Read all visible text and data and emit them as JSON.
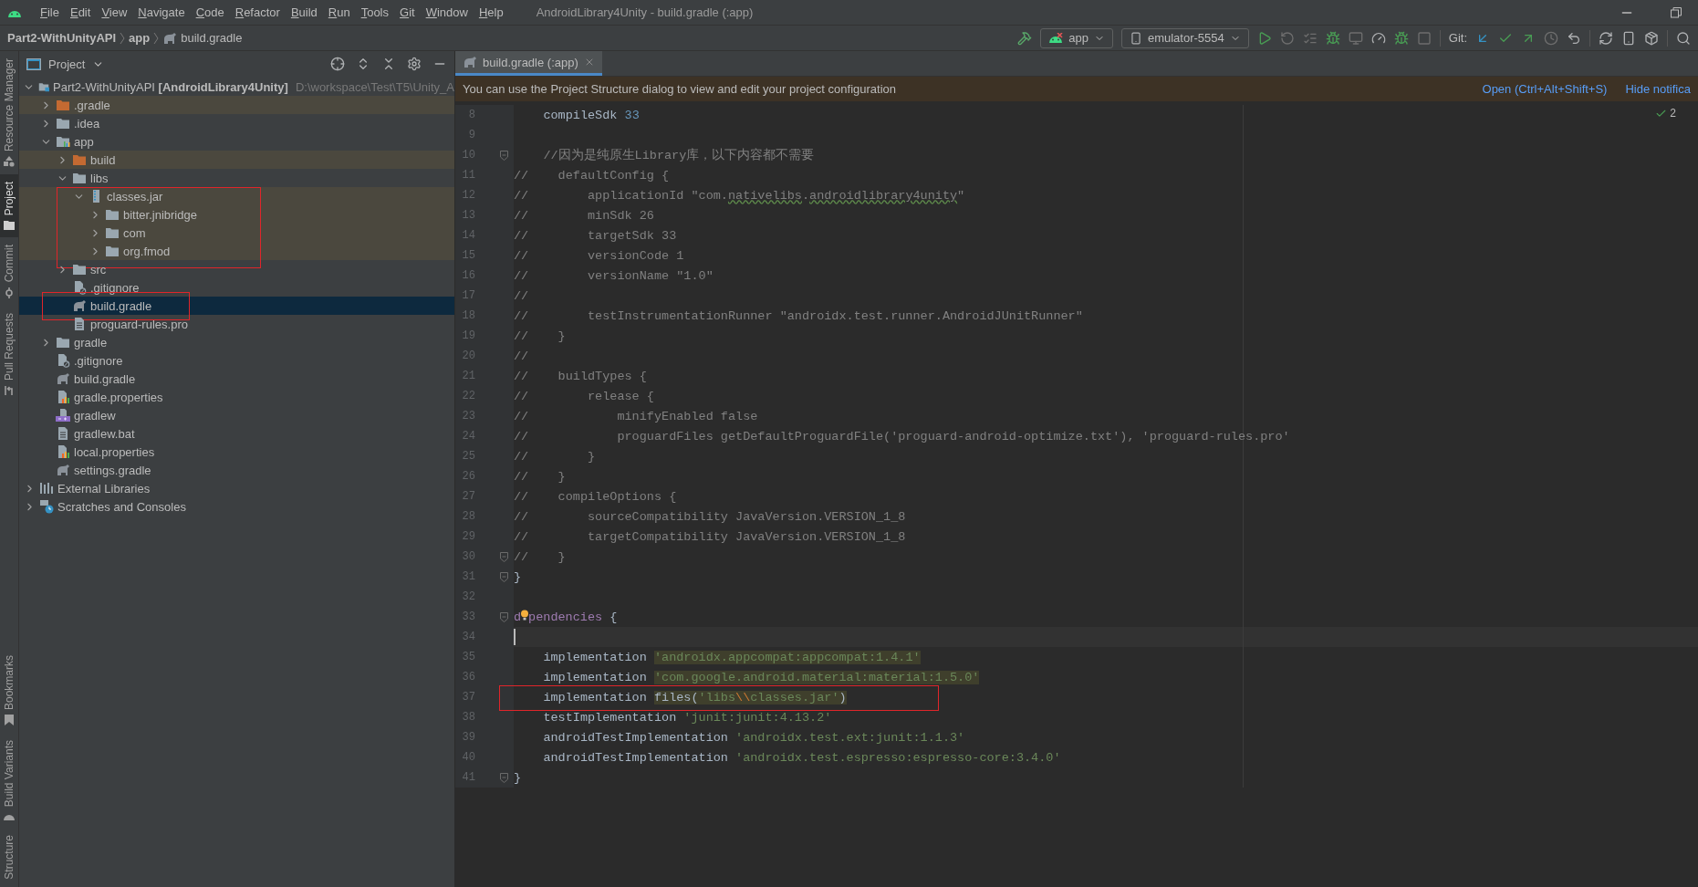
{
  "menu_bar": {
    "items": [
      "File",
      "Edit",
      "View",
      "Navigate",
      "Code",
      "Refactor",
      "Build",
      "Run",
      "Tools",
      "Git",
      "Window",
      "Help"
    ],
    "title": "AndroidLibrary4Unity - build.gradle (:app)"
  },
  "nav_bar": {
    "breadcrumbs": [
      {
        "label": "Part2-WithUnityAPI",
        "kind": "project"
      },
      {
        "label": "app",
        "kind": "module"
      },
      {
        "label": "build.gradle",
        "kind": "gradle"
      }
    ]
  },
  "toolbar": {
    "config": "app",
    "device": "emulator-5554",
    "git_label": "Git:"
  },
  "side_stripe": {
    "top": [
      {
        "label": "Resource Manager",
        "selected": false
      },
      {
        "label": "Project",
        "selected": true
      },
      {
        "label": "Commit",
        "selected": false
      },
      {
        "label": "Pull Requests",
        "selected": false
      }
    ],
    "bottom": [
      {
        "label": "Bookmarks",
        "selected": false
      },
      {
        "label": "Build Variants",
        "selected": false
      },
      {
        "label": "Structure",
        "selected": false
      }
    ]
  },
  "project_panel": {
    "title": "Project",
    "tree": [
      {
        "label": "Part2-WithUnityAPI **[AndroidLibrary4Unity]**",
        "hint": "D:\\workspace\\Test\\T5\\Unity_A",
        "kind": "module-root",
        "expanded": true,
        "selected": false,
        "tinted": false,
        "children": [
          {
            "label": ".gradle",
            "kind": "excluded-folder",
            "expanded": false,
            "selected": false,
            "tinted": true
          },
          {
            "label": ".idea",
            "kind": "folder",
            "expanded": false,
            "selected": false,
            "tinted": false
          },
          {
            "label": "app",
            "kind": "module",
            "expanded": true,
            "selected": false,
            "tinted": false,
            "children": [
              {
                "label": "build",
                "kind": "excluded-folder",
                "expanded": false,
                "selected": false,
                "tinted": true
              },
              {
                "label": "libs",
                "kind": "folder",
                "expanded": true,
                "selected": false,
                "tinted": false,
                "children": [
                  {
                    "label": "classes.jar",
                    "kind": "jar",
                    "expanded": true,
                    "selected": false,
                    "tinted": true,
                    "annotated": true,
                    "children": [
                      {
                        "label": "bitter.jnibridge",
                        "kind": "folder",
                        "expanded": false,
                        "selected": false,
                        "tinted": true
                      },
                      {
                        "label": "com",
                        "kind": "folder",
                        "expanded": false,
                        "selected": false,
                        "tinted": true
                      },
                      {
                        "label": "org.fmod",
                        "kind": "folder",
                        "expanded": false,
                        "selected": false,
                        "tinted": true
                      }
                    ]
                  }
                ]
              },
              {
                "label": "src",
                "kind": "folder",
                "expanded": false,
                "selected": false,
                "tinted": false
              },
              {
                "label": ".gitignore",
                "kind": "ignore",
                "selected": false,
                "tinted": false
              },
              {
                "label": "build.gradle",
                "kind": "gradle",
                "selected": true,
                "tinted": false,
                "annotated": true
              },
              {
                "label": "proguard-rules.pro",
                "kind": "text",
                "selected": false,
                "tinted": false
              }
            ]
          },
          {
            "label": "gradle",
            "kind": "folder",
            "expanded": false,
            "selected": false,
            "tinted": false
          },
          {
            "label": ".gitignore",
            "kind": "ignore",
            "selected": false,
            "tinted": false
          },
          {
            "label": "build.gradle",
            "kind": "gradle",
            "selected": false,
            "tinted": false
          },
          {
            "label": "gradle.properties",
            "kind": "properties",
            "selected": false,
            "tinted": false
          },
          {
            "label": "gradlew",
            "kind": "script",
            "selected": false,
            "tinted": false
          },
          {
            "label": "gradlew.bat",
            "kind": "text",
            "selected": false,
            "tinted": false
          },
          {
            "label": "local.properties",
            "kind": "properties",
            "selected": false,
            "tinted": false
          },
          {
            "label": "settings.gradle",
            "kind": "gradle",
            "selected": false,
            "tinted": false
          }
        ]
      },
      {
        "label": "External Libraries",
        "kind": "libraries",
        "expanded": false,
        "selected": false,
        "tinted": false
      },
      {
        "label": "Scratches and Consoles",
        "kind": "scratches",
        "expanded": false,
        "selected": false,
        "tinted": false
      }
    ]
  },
  "editor": {
    "tab": {
      "label": "build.gradle (:app)",
      "selected": true
    },
    "notification": {
      "text": "You can use the Project Structure dialog to view and edit your project configuration",
      "links": [
        "Open (Ctrl+Alt+Shift+S)",
        "Hide notifica"
      ]
    },
    "inspection_count": "2",
    "lines": [
      {
        "number": "8",
        "tokens": [
          {
            "text": "    compileSdk ",
            "kind": "plain"
          },
          {
            "text": "33",
            "kind": "number"
          }
        ]
      },
      {
        "number": "9"
      },
      {
        "number": "10",
        "fold": true,
        "tokens": [
          {
            "text": "    //因为是纯原生Library库，以下内容都不需要",
            "kind": "comment"
          }
        ]
      },
      {
        "number": "11",
        "tokens": [
          {
            "text": "//    defaultConfig {",
            "kind": "comment"
          }
        ]
      },
      {
        "number": "12",
        "tokens": [
          {
            "text": "//        applicationId \"com.",
            "kind": "comment"
          },
          {
            "text": "nativelibs",
            "kind": "typo"
          },
          {
            "text": ".",
            "kind": "comment"
          },
          {
            "text": "androidlibrary4unity",
            "kind": "typo"
          },
          {
            "text": "\"",
            "kind": "comment"
          }
        ]
      },
      {
        "number": "13",
        "tokens": [
          {
            "text": "//        minSdk 26",
            "kind": "comment"
          }
        ]
      },
      {
        "number": "14",
        "tokens": [
          {
            "text": "//        targetSdk 33",
            "kind": "comment"
          }
        ]
      },
      {
        "number": "15",
        "tokens": [
          {
            "text": "//        versionCode 1",
            "kind": "comment"
          }
        ]
      },
      {
        "number": "16",
        "tokens": [
          {
            "text": "//        versionName \"1.0\"",
            "kind": "comment"
          }
        ]
      },
      {
        "number": "17",
        "tokens": [
          {
            "text": "//",
            "kind": "comment"
          }
        ]
      },
      {
        "number": "18",
        "tokens": [
          {
            "text": "//        testInstrumentationRunner \"androidx.test.runner.AndroidJUnitRunner\"",
            "kind": "comment"
          }
        ]
      },
      {
        "number": "19",
        "tokens": [
          {
            "text": "//    }",
            "kind": "comment"
          }
        ]
      },
      {
        "number": "20",
        "tokens": [
          {
            "text": "//",
            "kind": "comment"
          }
        ]
      },
      {
        "number": "21",
        "tokens": [
          {
            "text": "//    buildTypes {",
            "kind": "comment"
          }
        ]
      },
      {
        "number": "22",
        "tokens": [
          {
            "text": "//        release {",
            "kind": "comment"
          }
        ]
      },
      {
        "number": "23",
        "tokens": [
          {
            "text": "//            minifyEnabled false",
            "kind": "comment"
          }
        ]
      },
      {
        "number": "24",
        "tokens": [
          {
            "text": "//            proguardFiles getDefaultProguardFile('proguard-android-optimize.txt'), 'proguard-rules.pro'",
            "kind": "comment"
          }
        ]
      },
      {
        "number": "25",
        "tokens": [
          {
            "text": "//        }",
            "kind": "comment"
          }
        ]
      },
      {
        "number": "26",
        "tokens": [
          {
            "text": "//    }",
            "kind": "comment"
          }
        ]
      },
      {
        "number": "27",
        "tokens": [
          {
            "text": "//    compileOptions {",
            "kind": "comment"
          }
        ]
      },
      {
        "number": "28",
        "tokens": [
          {
            "text": "//        sourceCompatibility JavaVersion.VERSION_1_8",
            "kind": "comment"
          }
        ]
      },
      {
        "number": "29",
        "tokens": [
          {
            "text": "//        targetCompatibility JavaVersion.VERSION_1_8",
            "kind": "comment"
          }
        ]
      },
      {
        "number": "30",
        "fold": true,
        "tokens": [
          {
            "text": "//    }",
            "kind": "comment"
          }
        ]
      },
      {
        "number": "31",
        "fold": true,
        "tokens": [
          {
            "text": "}",
            "kind": "plain"
          }
        ]
      },
      {
        "number": "32"
      },
      {
        "number": "33",
        "fold": true,
        "tokens": [
          {
            "text": "d",
            "kind": "method"
          },
          {
            "kind": "bulb"
          },
          {
            "text": "pendencies",
            "kind": "method"
          },
          {
            "text": " {",
            "kind": "plain"
          }
        ]
      },
      {
        "number": "34",
        "current": true
      },
      {
        "number": "35",
        "tokens": [
          {
            "text": "    implementation ",
            "kind": "plain"
          },
          {
            "text": "'androidx.appcompat:appcompat:1.4.1'",
            "kind": "string",
            "marked": true
          }
        ]
      },
      {
        "number": "36",
        "tokens": [
          {
            "text": "    implementation ",
            "kind": "plain"
          },
          {
            "text": "'com.google.android.material:material:1.5.0'",
            "kind": "string",
            "marked": true
          }
        ]
      },
      {
        "number": "37",
        "annotated": true,
        "tokens": [
          {
            "text": "    implementation ",
            "kind": "plain"
          },
          {
            "text": "files(",
            "kind": "plain",
            "marked": true
          },
          {
            "text": "'libs",
            "kind": "string",
            "marked": true
          },
          {
            "text": "\\\\",
            "kind": "escape",
            "marked": true
          },
          {
            "text": "classes.jar'",
            "kind": "string",
            "marked": true
          },
          {
            "text": ")",
            "kind": "plain",
            "marked": true
          }
        ]
      },
      {
        "number": "38",
        "tokens": [
          {
            "text": "    testImplementation ",
            "kind": "plain"
          },
          {
            "text": "'junit:junit:4.13.2'",
            "kind": "string"
          }
        ]
      },
      {
        "number": "39",
        "tokens": [
          {
            "text": "    androidTestImplementation ",
            "kind": "plain"
          },
          {
            "text": "'androidx.test.ext:junit:1.1.3'",
            "kind": "string"
          }
        ]
      },
      {
        "number": "40",
        "tokens": [
          {
            "text": "    androidTestImplementation ",
            "kind": "plain"
          },
          {
            "text": "'androidx.test.espresso:espresso-core:3.4.0'",
            "kind": "string"
          }
        ]
      },
      {
        "number": "41",
        "fold": true,
        "tokens": [
          {
            "text": "}",
            "kind": "plain"
          }
        ]
      }
    ]
  }
}
